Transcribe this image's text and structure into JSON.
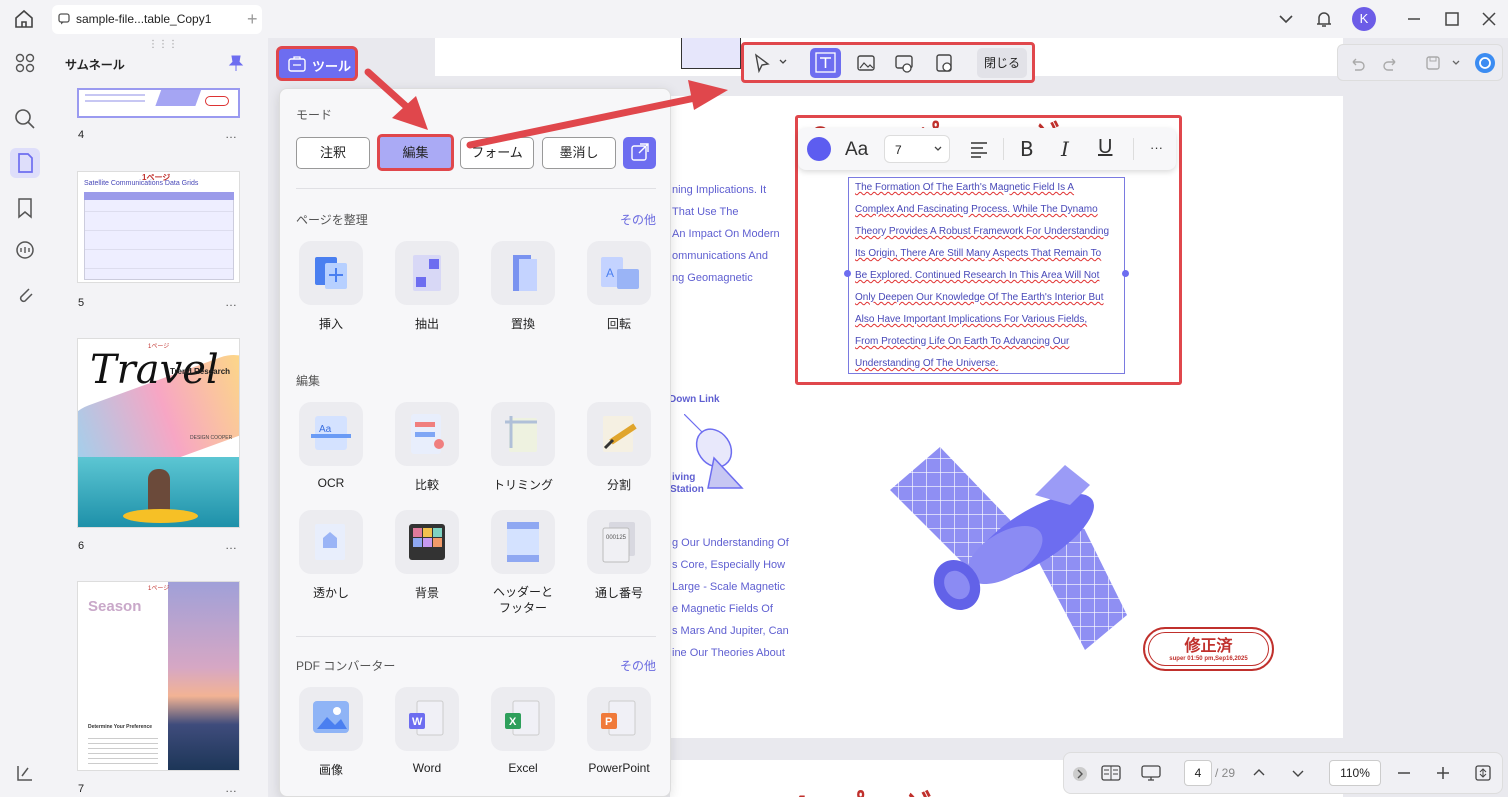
{
  "tab": {
    "title": "sample-file...table_Copy1"
  },
  "user": {
    "avatar_initial": "K"
  },
  "thumbs": {
    "title": "サムネール",
    "pages": [
      {
        "num": "4",
        "more": "…"
      },
      {
        "num": "5",
        "more": "…",
        "title": "Satellite Communications Data Grids",
        "stamp": "1ページ"
      },
      {
        "num": "6",
        "more": "…",
        "script": "Travel",
        "title": "Trend Research",
        "author": "DESIGN COOPER",
        "stamp": "1ページ"
      },
      {
        "num": "7",
        "more": "…",
        "title": "Season",
        "subtitle": "Determine Your Preference",
        "stamp": "1ページ"
      }
    ]
  },
  "tools": {
    "button_label": "ツール",
    "mode_label": "モード",
    "modes": [
      "注釈",
      "編集",
      "フォーム",
      "墨消し"
    ],
    "sections": [
      {
        "title": "ページを整理",
        "more": "その他",
        "items": [
          "挿入",
          "抽出",
          "置換",
          "回転"
        ]
      },
      {
        "title": "編集",
        "items": [
          "OCR",
          "比較",
          "トリミング",
          "分割",
          "透かし",
          "背景",
          "ヘッダーと\nフッター",
          "通し番号"
        ]
      },
      {
        "title": "PDF コンバーター",
        "more": "その他",
        "items": [
          "画像",
          "Word",
          "Excel",
          "PowerPoint"
        ]
      }
    ]
  },
  "edit_toolbar": {
    "close_label": "閉じる"
  },
  "format_bar": {
    "font_icon": "Aa",
    "font_size": "7",
    "more": "···"
  },
  "document": {
    "left_lines": [
      "ning Implications. It",
      "That Use The",
      "An Impact On Modern",
      "ommunications And",
      "ng Geomagnetic"
    ],
    "down_link": "Down Link",
    "receiving": [
      "iving",
      "Station"
    ],
    "lower_lines": [
      "g Our Understanding Of",
      "s Core, Especially How",
      "Large - Scale Magnetic",
      "e Magnetic Fields Of",
      "s Mars And Jupiter, Can",
      "ine Our Theories About"
    ],
    "textbox_lines": [
      "The Formation Of The Earth's Magnetic Field Is A",
      "Complex And Fascinating Process. While The Dynamo",
      "Theory Provides A Robust Framework For Understanding",
      "Its Origin, There Are Still Many Aspects That Remain To",
      "Be Explored. Continued Research In This Area Will Not",
      "Only Deepen Our Knowledge Of The Earth's Interior But",
      "Also Have Important Implications For Various Fields,",
      "From Protecting Life On Earth To Advancing Our",
      "Understanding Of The Universe."
    ],
    "stamp_title": "修正済",
    "stamp_sub": "super 01:50 pm,Sep16,2025"
  },
  "bottom": {
    "page": "4",
    "total": "/ 29",
    "zoom": "110%"
  },
  "colors": {
    "accent": "#6d6df0",
    "highlight": "#e0474c",
    "doc_text": "#5f5fd1"
  }
}
